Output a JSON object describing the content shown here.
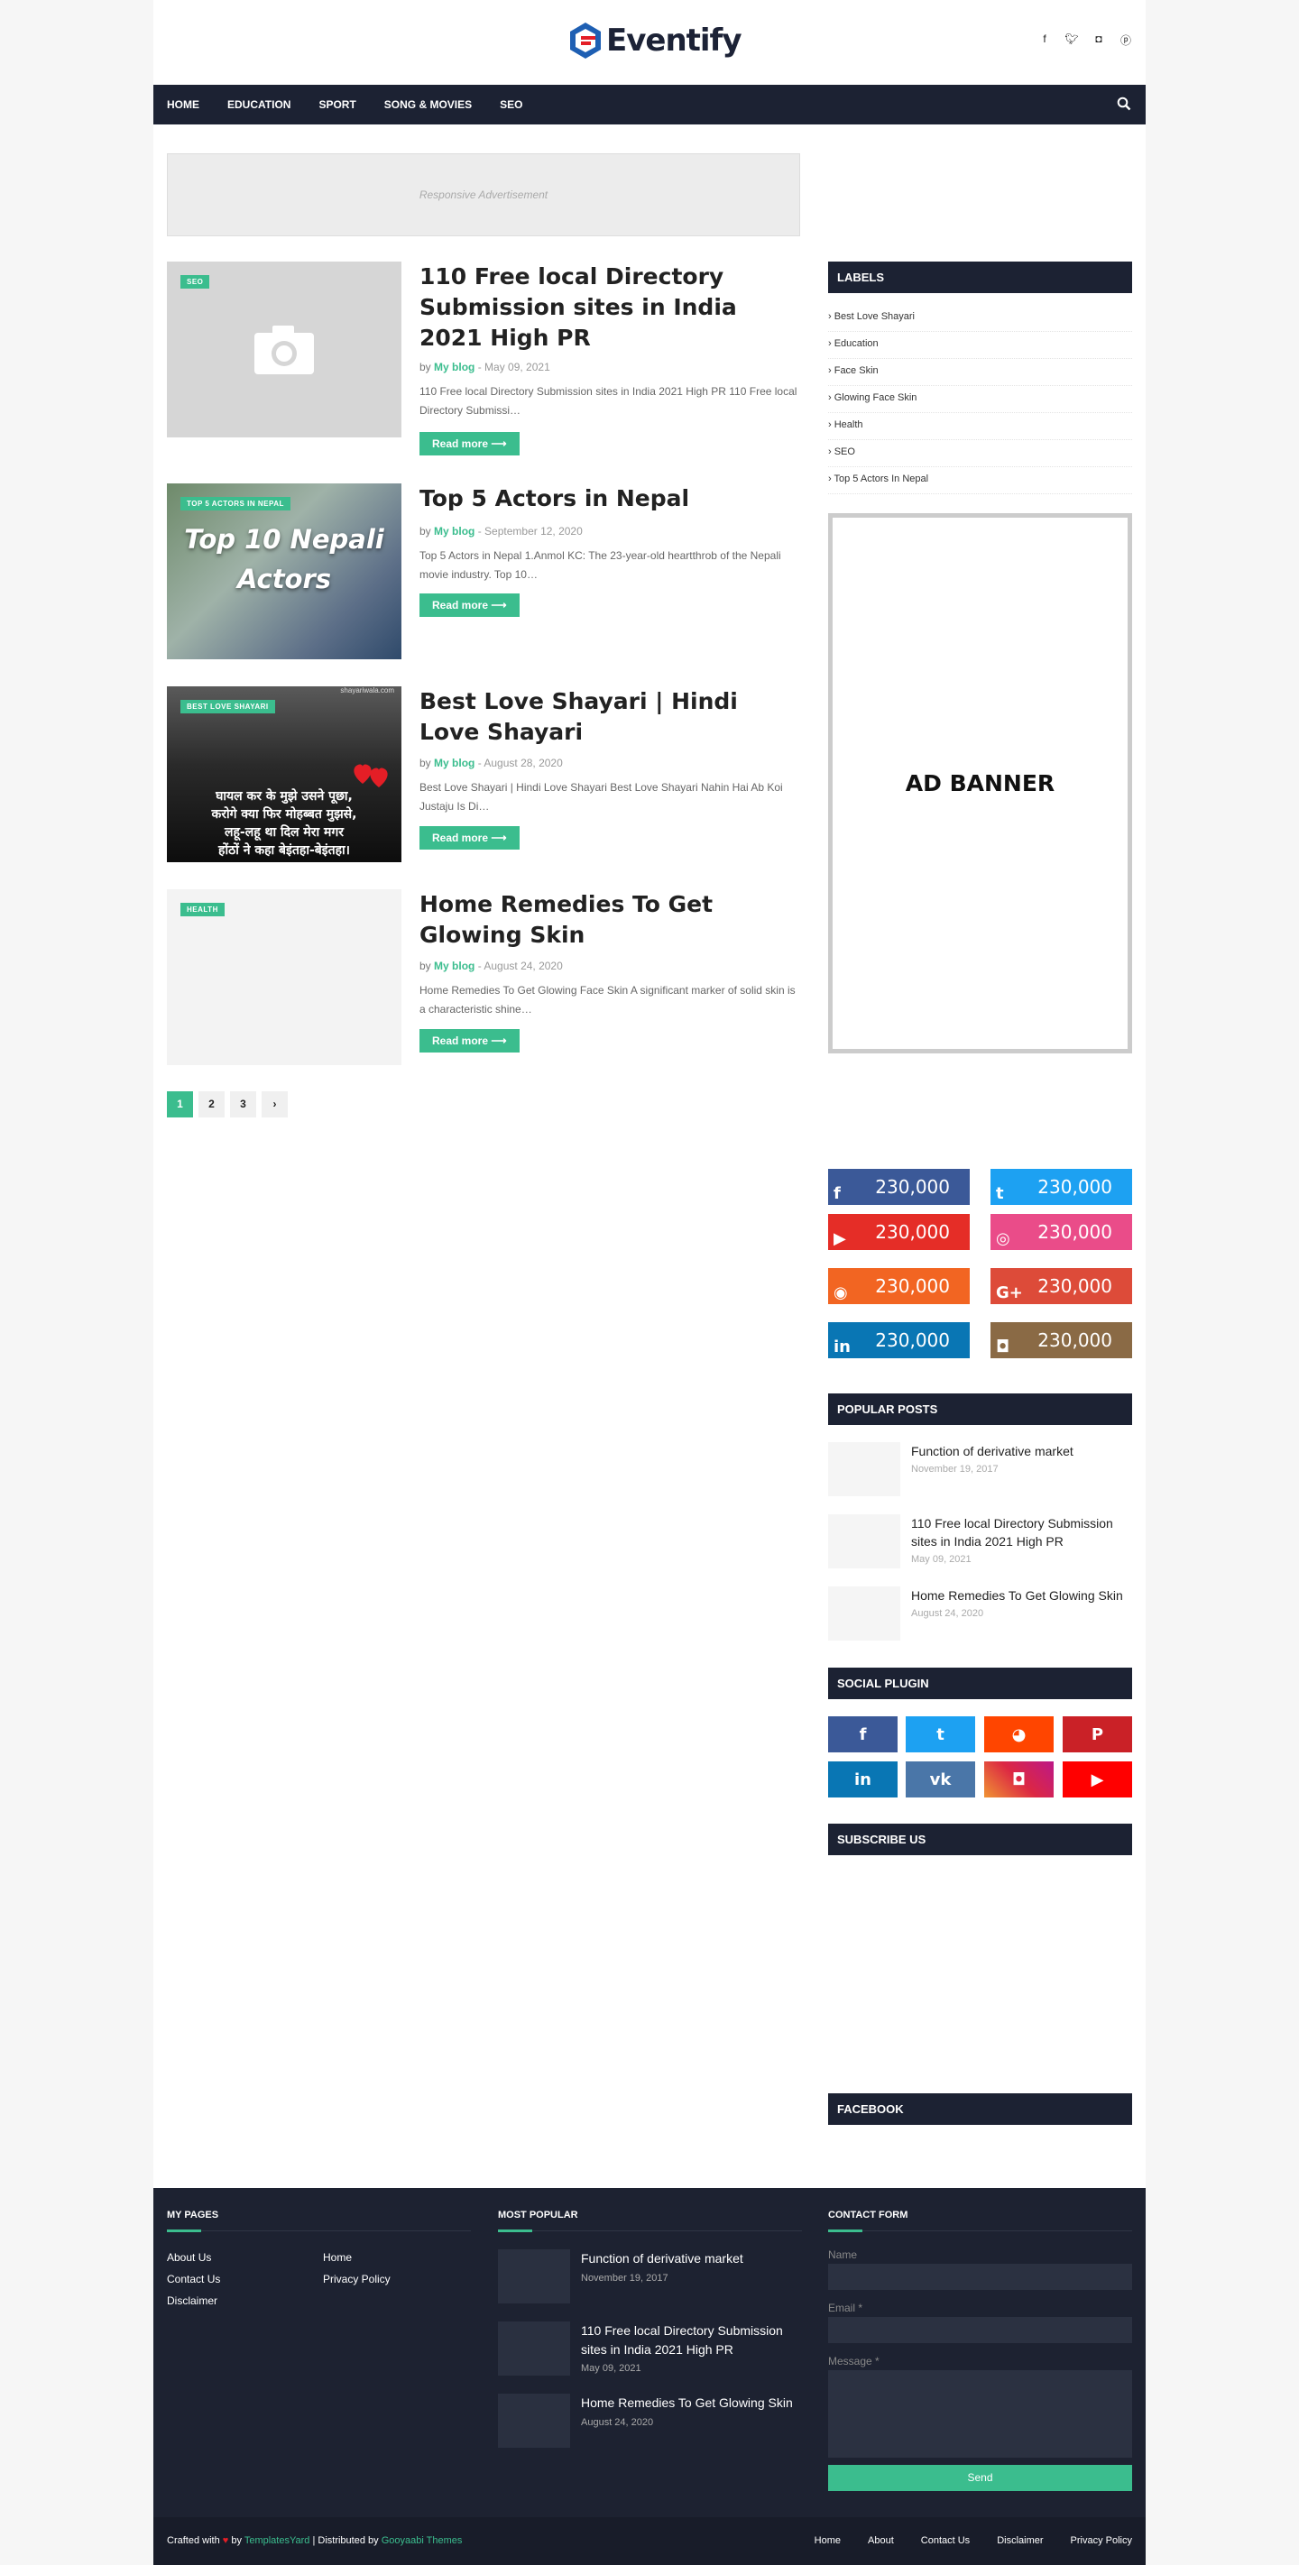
{
  "header": {
    "logo_text": "Eventify",
    "social_icons": [
      "facebook-icon",
      "twitter-icon",
      "instagram-icon",
      "pinterest-icon"
    ]
  },
  "nav": {
    "items": [
      "HOME",
      "EDUCATION",
      "SPORT",
      "SONG & MOVIES",
      "SEO"
    ]
  },
  "ad_top": "Responsive Advertisement",
  "posts": [
    {
      "tag": "SEO",
      "title": "110 Free local Directory Submission sites in India 2021 High PR",
      "by": "by",
      "author": "My blog",
      "date": "- May 09, 2021",
      "snippet": "110 Free local Directory Submission sites in India 2021 High PR 110 Free local Directory Submissi…",
      "more": "Read more"
    },
    {
      "tag": "TOP 5 ACTORS IN NEPAL",
      "thumb_text": "Top 10 Nepali Actors",
      "title": "Top 5 Actors in Nepal",
      "by": "by",
      "author": "My blog",
      "date": "- September 12, 2020",
      "snippet": "Top 5 Actors in Nepal 1.Anmol KC: The 23-year-old heartthrob of the Nepali movie industry. Top 10…",
      "more": "Read more"
    },
    {
      "tag": "BEST LOVE SHAYARI",
      "thumb_lines": [
        "घायल कर के मुझे उसने पूछा,",
        "करोगे क्या फिर मोहब्बत मुझसे,",
        "लहू-लहू था दिल मेरा मगर",
        "होंठों ने कहा बेइंतहा-बेइंतहा।"
      ],
      "thumb_site": "shayariwala.com",
      "title": "Best Love Shayari | Hindi Love Shayari",
      "by": "by",
      "author": "My blog",
      "date": "- August 28, 2020",
      "snippet": "Best Love Shayari | Hindi Love Shayari Best Love Shayari Nahin Hai Ab Koi Justaju Is Di…",
      "more": "Read more"
    },
    {
      "tag": "HEALTH",
      "title": "Home Remedies To Get Glowing Skin",
      "by": "by",
      "author": "My blog",
      "date": "- August 24, 2020",
      "snippet": "Home Remedies To Get Glowing Face Skin A significant marker of solid skin is a characteristic shine…",
      "more": "Read more"
    }
  ],
  "pagination": [
    "1",
    "2",
    "3",
    "›"
  ],
  "sidebar": {
    "labels_title": "LABELS",
    "labels": [
      "› Best Love Shayari",
      "› Education",
      "› Face Skin",
      "› Glowing Face Skin",
      "› Health",
      "› SEO",
      "› Top 5 Actors In Nepal"
    ],
    "ad_banner": "AD BANNER",
    "social_counters": [
      {
        "icon": "facebook-icon",
        "glyph": "f",
        "count": "230,000",
        "color": "#3b5998"
      },
      {
        "icon": "twitter-icon",
        "glyph": "t",
        "count": "230,000",
        "color": "#1da1f2"
      },
      {
        "icon": "youtube-icon",
        "glyph": "▶",
        "count": "230,000",
        "color": "#e52d27"
      },
      {
        "icon": "dribbble-icon",
        "glyph": "◎",
        "count": "230,000",
        "color": "#ea4c89"
      },
      {
        "icon": "rss-icon",
        "glyph": "◉",
        "count": "230,000",
        "color": "#f26522"
      },
      {
        "icon": "google-plus-icon",
        "glyph": "G+",
        "count": "230,000",
        "color": "#dd4b39"
      },
      {
        "icon": "linkedin-icon",
        "glyph": "in",
        "count": "230,000",
        "color": "#0976b4"
      },
      {
        "icon": "instagram-icon",
        "glyph": "◘",
        "count": "230,000",
        "color": "#8a6a45"
      }
    ],
    "popular_title": "POPULAR POSTS",
    "popular": [
      {
        "title": "Function of derivative market",
        "date": "November 19, 2017"
      },
      {
        "title": "110 Free local Directory Submission sites in India 2021 High PR",
        "date": "May 09, 2021"
      },
      {
        "title": "Home Remedies To Get Glowing Skin",
        "date": "August 24, 2020"
      }
    ],
    "social_plugin_title": "SOCIAL PLUGIN",
    "social_plugin": [
      {
        "icon": "facebook-icon",
        "glyph": "f",
        "color": "#3b5998"
      },
      {
        "icon": "twitter-icon",
        "glyph": "t",
        "color": "#1da1f2"
      },
      {
        "icon": "reddit-icon",
        "glyph": "◕",
        "color": "#ff4500"
      },
      {
        "icon": "pinterest-icon",
        "glyph": "P",
        "color": "#ca2127"
      },
      {
        "icon": "linkedin-icon",
        "glyph": "in",
        "color": "#0976b4"
      },
      {
        "icon": "vk-icon",
        "glyph": "vk",
        "color": "#4a76a8"
      },
      {
        "icon": "instagram-icon",
        "glyph": "◘",
        "color": "#c13584"
      },
      {
        "icon": "youtube-icon",
        "glyph": "▶",
        "color": "#ff0000"
      }
    ],
    "subscribe_title": "SUBSCRIBE US",
    "facebook_title": "FACEBOOK"
  },
  "footer": {
    "pages_title": "MY PAGES",
    "pages_col1": [
      "About Us",
      "Contact Us",
      "Disclaimer"
    ],
    "pages_col2": [
      "Home",
      "Privacy Policy"
    ],
    "popular_title": "MOST POPULAR",
    "popular": [
      {
        "title": "Function of derivative market",
        "date": "November 19, 2017"
      },
      {
        "title": "110 Free local Directory Submission sites in India 2021 High PR",
        "date": "May 09, 2021"
      },
      {
        "title": "Home Remedies To Get Glowing Skin",
        "date": "August 24, 2020"
      }
    ],
    "contact_title": "CONTACT FORM",
    "name_label": "Name",
    "email_label": "Email *",
    "message_label": "Message *",
    "send_label": "Send"
  },
  "bottom": {
    "crafted": "Crafted with",
    "by": "by",
    "templates": "TemplatesYard",
    "distributed": "| Distributed by",
    "gooyaabi": "Gooyaabi Themes",
    "links": [
      "Home",
      "About",
      "Contact Us",
      "Disclaimer",
      "Privacy Policy"
    ]
  },
  "colors": {
    "accent": "#3bbd8e",
    "dark": "#1c2233"
  }
}
